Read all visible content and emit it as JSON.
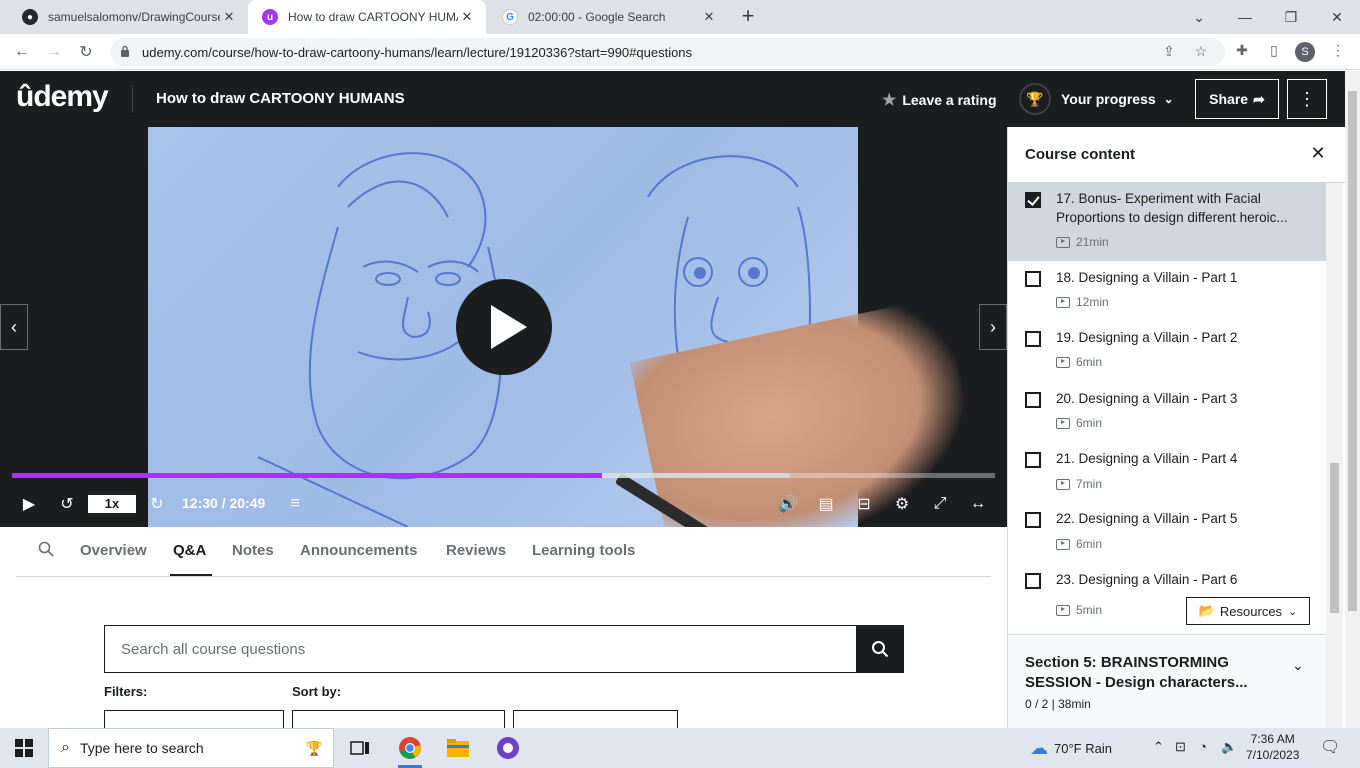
{
  "browser": {
    "tabs": [
      {
        "title": "samuelsalomonv/DrawingCourse",
        "favicon": "github-icon"
      },
      {
        "title": "How to draw CARTOONY HUMANS",
        "favicon": "udemy-icon"
      },
      {
        "title": "02:00:00 - Google Search",
        "favicon": "google-icon"
      }
    ],
    "url": "udemy.com/course/how-to-draw-cartoony-humans/learn/lecture/19120336?start=990#questions",
    "profile_initial": "S"
  },
  "header": {
    "logo": "ûdemy",
    "course_title": "How to draw CARTOONY HUMANS",
    "rating_label": "Leave a rating",
    "progress_label": "Your progress",
    "share_label": "Share"
  },
  "player": {
    "progress_fraction": 0.6,
    "buffered_fraction": 0.79,
    "speed": "1x",
    "time": "12:30 / 20:49"
  },
  "content_tabs": [
    "Overview",
    "Q&A",
    "Notes",
    "Announcements",
    "Reviews",
    "Learning tools"
  ],
  "qa": {
    "search_placeholder": "Search all course questions",
    "filters_label": "Filters:",
    "sort_label": "Sort by:"
  },
  "sidebar": {
    "title": "Course content",
    "lectures": [
      {
        "title": "17. Bonus- Experiment with Facial Proportions to design different heroic...",
        "duration": "21min",
        "checked": true,
        "current": true
      },
      {
        "title": "18. Designing a Villain - Part 1",
        "duration": "12min",
        "checked": false
      },
      {
        "title": "19. Designing a Villain - Part 2",
        "duration": "6min",
        "checked": false
      },
      {
        "title": "20. Designing a Villain - Part 3",
        "duration": "6min",
        "checked": false
      },
      {
        "title": "21. Designing a Villain - Part 4",
        "duration": "7min",
        "checked": false
      },
      {
        "title": "22. Designing a Villain - Part 5",
        "duration": "6min",
        "checked": false
      },
      {
        "title": "23. Designing a Villain - Part 6",
        "duration": "5min",
        "checked": false
      }
    ],
    "resources_label": "Resources",
    "section": {
      "title": "Section 5: BRAINSTORMING SESSION - Design characters...",
      "meta": "0 / 2 | 38min"
    }
  },
  "taskbar": {
    "search_placeholder": "Type here to search",
    "weather": "70°F  Rain",
    "time": "7:36 AM",
    "date": "7/10/2023"
  },
  "colors": {
    "accent": "#a435f0",
    "header_bg": "#1c1d1f"
  }
}
